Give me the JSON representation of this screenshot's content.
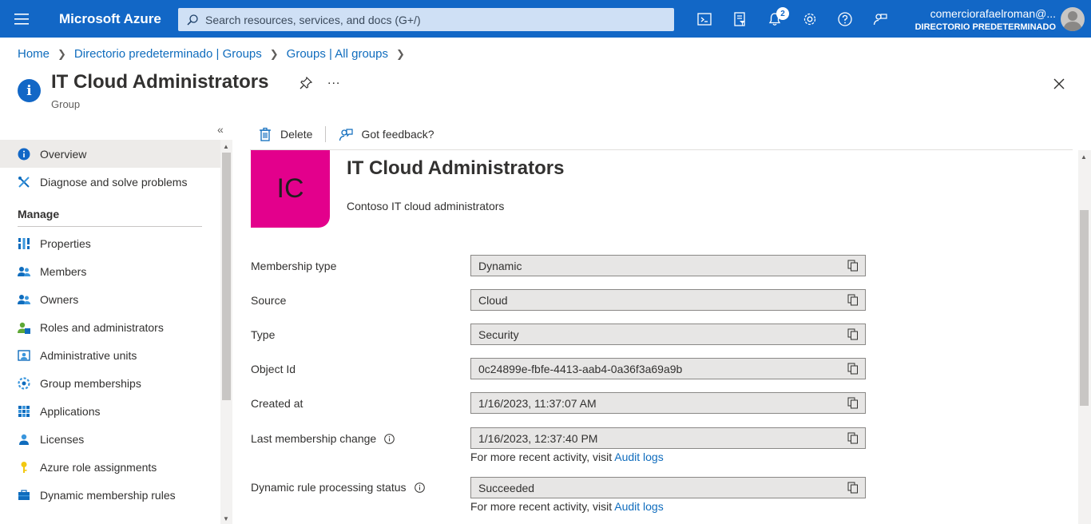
{
  "topbar": {
    "brand": "Microsoft Azure",
    "search_placeholder": "Search resources, services, and docs (G+/)",
    "notifications_count": "2",
    "account_email": "comerciorafaelroman@...",
    "account_directory": "DIRECTORIO PREDETERMINADO",
    "icons": [
      "cloud-shell-icon",
      "directory-filter-icon",
      "notifications-icon",
      "settings-icon",
      "help-icon",
      "feedback-icon"
    ]
  },
  "breadcrumb": [
    {
      "label": "Home"
    },
    {
      "label": "Directorio predeterminado | Groups"
    },
    {
      "label": "Groups | All groups"
    }
  ],
  "header": {
    "title": "IT Cloud Administrators",
    "subtitle": "Group",
    "more": "..."
  },
  "sidebar": {
    "items_top": [
      {
        "label": "Overview",
        "icon": "info-icon",
        "active": true
      },
      {
        "label": "Diagnose and solve problems",
        "icon": "wrench-icon",
        "active": false
      }
    ],
    "section_manage": "Manage",
    "items_manage": [
      {
        "label": "Properties",
        "icon": "properties-icon"
      },
      {
        "label": "Members",
        "icon": "members-icon"
      },
      {
        "label": "Owners",
        "icon": "owners-icon"
      },
      {
        "label": "Roles and administrators",
        "icon": "roles-icon"
      },
      {
        "label": "Administrative units",
        "icon": "admin-units-icon"
      },
      {
        "label": "Group memberships",
        "icon": "group-memberships-icon"
      },
      {
        "label": "Applications",
        "icon": "applications-icon"
      },
      {
        "label": "Licenses",
        "icon": "licenses-icon"
      },
      {
        "label": "Azure role assignments",
        "icon": "key-icon"
      },
      {
        "label": "Dynamic membership rules",
        "icon": "dynamic-rules-icon"
      }
    ]
  },
  "commands": {
    "delete": "Delete",
    "feedback": "Got feedback?"
  },
  "group": {
    "initials": "IC",
    "name": "IT Cloud Administrators",
    "description": "Contoso IT cloud administrators",
    "tile_color": "#e3008c"
  },
  "properties": [
    {
      "label": "Membership type",
      "value": "Dynamic"
    },
    {
      "label": "Source",
      "value": "Cloud"
    },
    {
      "label": "Type",
      "value": "Security"
    },
    {
      "label": "Object Id",
      "value": "0c24899e-fbfe-4413-aab4-0a36f3a69a9b"
    },
    {
      "label": "Created at",
      "value": "1/16/2023, 11:37:07 AM"
    },
    {
      "label": "Last membership change",
      "value": "1/16/2023, 12:37:40 PM"
    },
    {
      "label": "Dynamic rule processing status",
      "value": "Succeeded"
    }
  ],
  "hints": {
    "activity_text": "For more recent activity, visit ",
    "audit_link": "Audit logs"
  },
  "colors": {
    "topbar": "#1267c6",
    "link": "#0f6cbd",
    "tile": "#e3008c"
  }
}
